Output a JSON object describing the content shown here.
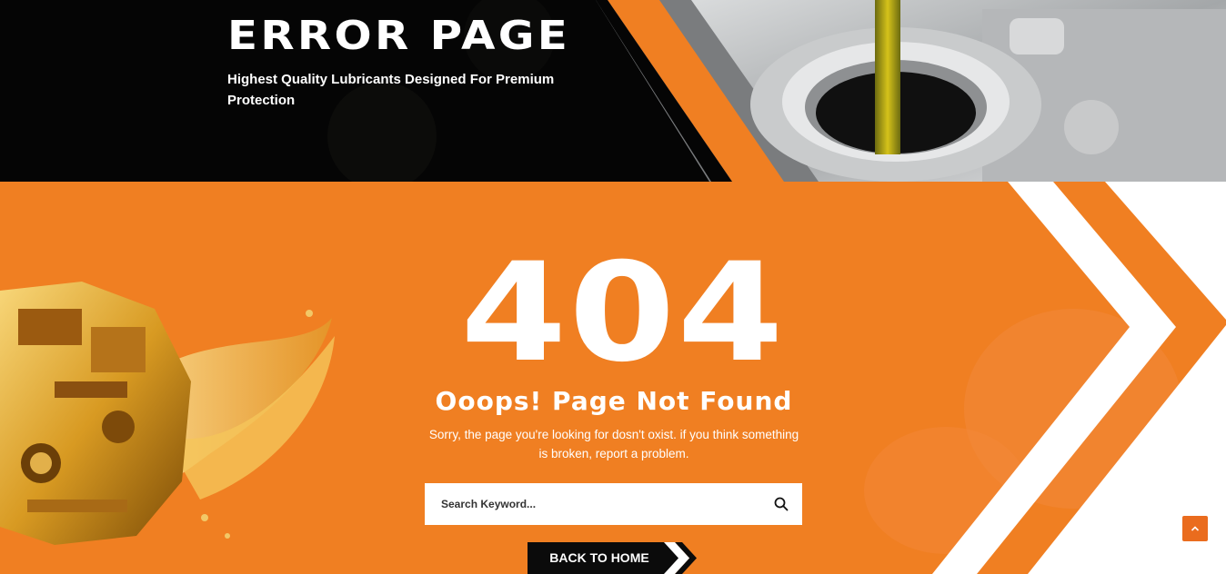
{
  "hero": {
    "title": "ERROR PAGE",
    "subtitle": "Highest Quality Lubricants Designed For Premium Protection"
  },
  "error": {
    "code": "404",
    "heading": "Ooops! Page Not Found",
    "message": "Sorry, the page you're looking for dosn't oxist. if you think something is broken, report a problem."
  },
  "search": {
    "placeholder": "Search Keyword...",
    "icon": "search-icon"
  },
  "home_button": {
    "label": "BACK TO HOME"
  },
  "scroll_top": {
    "icon": "chevron-up-icon"
  },
  "colors": {
    "accent": "#f07f22",
    "dark": "#050505",
    "white": "#ffffff"
  }
}
